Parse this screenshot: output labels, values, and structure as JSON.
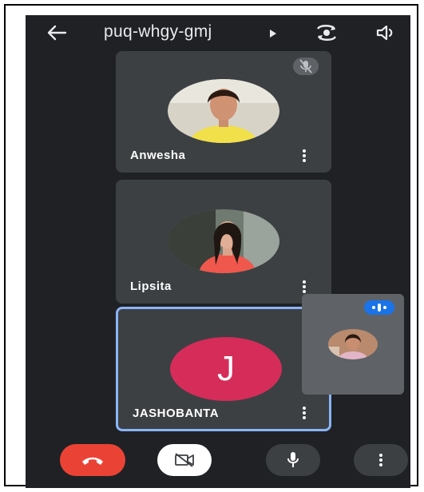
{
  "meeting": {
    "code": "puq-whgy-gmj"
  },
  "participants": [
    {
      "name": "Anwesha",
      "muted": true
    },
    {
      "name": "Lipsita",
      "muted": false
    },
    {
      "name": "JASHOBANTA",
      "initial": "J",
      "avatar_color": "#d52c5a",
      "active_speaker": true
    }
  ],
  "icons": {
    "back": "back-arrow-icon",
    "caret": "caret-right-icon",
    "switch_camera": "switch-camera-icon",
    "speaker": "speaker-icon",
    "mic_off": "mic-off-icon",
    "more": "more-vert-icon",
    "end_call": "end-call-icon",
    "video_off": "video-off-icon",
    "mic": "mic-icon",
    "audio_activity": "audio-activity-icon"
  },
  "colors": {
    "background": "#202124",
    "tile": "#3c4043",
    "active_border": "#8ab4f8",
    "end_call": "#ea4335",
    "accent_blue": "#1a73e8"
  }
}
